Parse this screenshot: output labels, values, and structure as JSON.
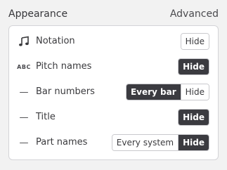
{
  "header": {
    "title": "Appearance",
    "advanced_label": "Advanced"
  },
  "rows": [
    {
      "icon": "music-note-icon",
      "icon_glyph": "♫",
      "label": "Notation",
      "options": [
        "Hide"
      ],
      "selected": null
    },
    {
      "icon": "abc-icon",
      "icon_glyph": "ABC",
      "label": "Pitch names",
      "options": [
        "Hide"
      ],
      "selected": "Hide"
    },
    {
      "icon": "dash-icon",
      "icon_glyph": "—",
      "label": "Bar numbers",
      "options": [
        "Every bar",
        "Hide"
      ],
      "selected": "Every bar"
    },
    {
      "icon": "dash-icon",
      "icon_glyph": "—",
      "label": "Title",
      "options": [
        "Hide"
      ],
      "selected": "Hide"
    },
    {
      "icon": "dash-icon",
      "icon_glyph": "—",
      "label": "Part names",
      "options": [
        "Every system",
        "Hide"
      ],
      "selected": "Hide"
    }
  ],
  "colors": {
    "background": "#f2f2f2",
    "card": "#ffffff",
    "active_segment": "#3b3b40",
    "border": "#d4d4d7"
  }
}
